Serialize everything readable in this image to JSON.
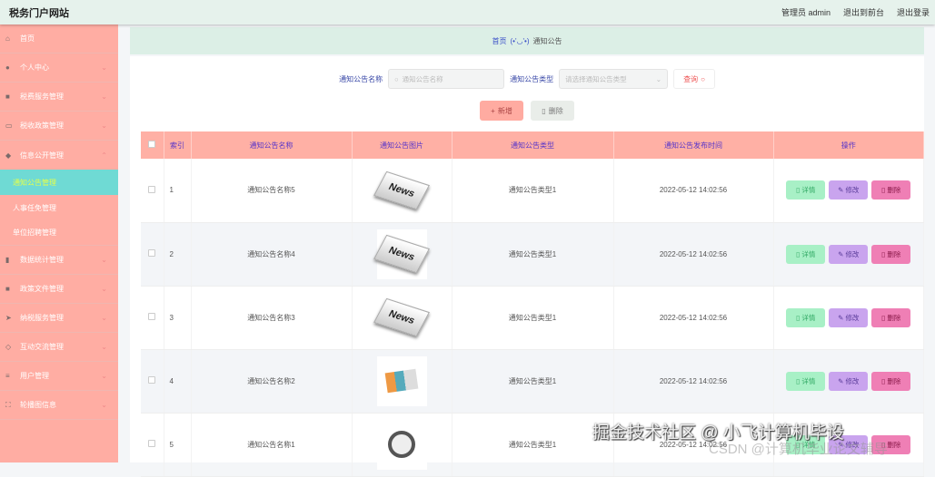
{
  "header": {
    "title": "税务门户网站",
    "user": "管理员 admin",
    "to_front": "退出到前台",
    "logout": "退出登录"
  },
  "sidebar": {
    "items": [
      {
        "label": "首页",
        "icon": "home-icon"
      },
      {
        "label": "个人中心",
        "icon": "user-icon"
      },
      {
        "label": "税费服务管理",
        "icon": "briefcase-icon"
      },
      {
        "label": "税收政策管理",
        "icon": "message-icon"
      },
      {
        "label": "信息公开管理",
        "icon": "folder-icon",
        "sub": [
          "通知公告管理",
          "人事任免管理",
          "单位招聘管理"
        ]
      },
      {
        "label": "数据统计管理",
        "icon": "chart-icon"
      },
      {
        "label": "政策文件管理",
        "icon": "document-icon"
      },
      {
        "label": "纳税服务管理",
        "icon": "send-icon"
      },
      {
        "label": "互动交流管理",
        "icon": "chat-icon"
      },
      {
        "label": "用户管理",
        "icon": "list-icon"
      },
      {
        "label": "轮播图信息",
        "icon": "fullscreen-icon"
      }
    ]
  },
  "breadcrumb": {
    "home": "首页",
    "sep": "(•'◡'•)",
    "current": "通知公告"
  },
  "search": {
    "name_label": "通知公告名称",
    "name_placeholder": "通知公告名称",
    "type_label": "通知公告类型",
    "type_placeholder": "请选择通知公告类型",
    "query": "查询"
  },
  "actions": {
    "add": "新增",
    "delete": "删除"
  },
  "table": {
    "headers": [
      "索引",
      "通知公告名称",
      "通知公告图片",
      "通知公告类型",
      "通知公告发布时间",
      "操作"
    ],
    "rows": [
      {
        "index": "1",
        "name": "通知公告名称5",
        "type": "通知公告类型1",
        "time": "2022-05-12 14:02:56",
        "img": "News"
      },
      {
        "index": "2",
        "name": "通知公告名称4",
        "type": "通知公告类型1",
        "time": "2022-05-12 14:02:56",
        "img": "News"
      },
      {
        "index": "3",
        "name": "通知公告名称3",
        "type": "通知公告类型1",
        "time": "2022-05-12 14:02:56",
        "img": "News"
      },
      {
        "index": "4",
        "name": "通知公告名称2",
        "type": "通知公告类型1",
        "time": "2022-05-12 14:02:56",
        "img": ""
      },
      {
        "index": "5",
        "name": "通知公告名称1",
        "type": "通知公告类型1",
        "time": "2022-05-12 14:02:56",
        "img": ""
      }
    ],
    "ops": {
      "detail": "详情",
      "edit": "修改",
      "delete": "删除"
    }
  },
  "watermark": {
    "line1": "掘金技术社区 @ 小飞计算机毕设",
    "line2": "CSDN @计算机毕业论文辅导"
  }
}
